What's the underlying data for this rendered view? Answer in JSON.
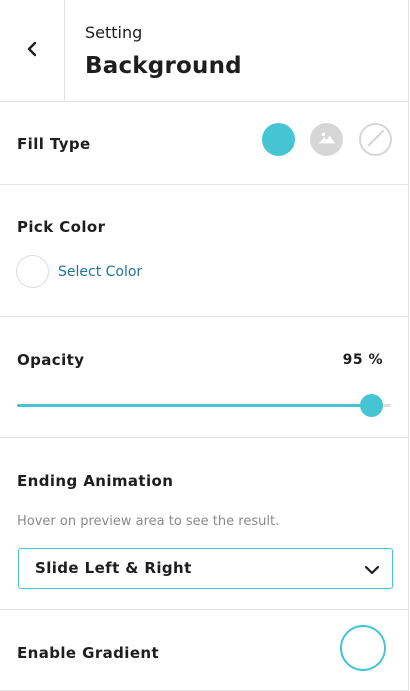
{
  "header": {
    "back_icon": "chevron-left-icon",
    "subtitle": "Setting",
    "title": "Background"
  },
  "fill_type": {
    "label": "Fill Type",
    "options": [
      {
        "icon": "color-fill-icon",
        "selected": true
      },
      {
        "icon": "image-icon",
        "selected": false
      },
      {
        "icon": "none-slash-icon",
        "selected": false
      }
    ]
  },
  "pick_color": {
    "label": "Pick Color",
    "link": "Select Color"
  },
  "opacity": {
    "label": "Opacity",
    "value": 95,
    "value_text": "95 %"
  },
  "ending_animation": {
    "label": "Ending Animation",
    "hint": "Hover on preview area to see the result.",
    "selected": "Slide Left & Right"
  },
  "gradient": {
    "label": "Enable Gradient",
    "enabled": false
  },
  "colors": {
    "accent": "#45c4d4",
    "link": "#20749a",
    "muted": "#d6d6d6"
  }
}
